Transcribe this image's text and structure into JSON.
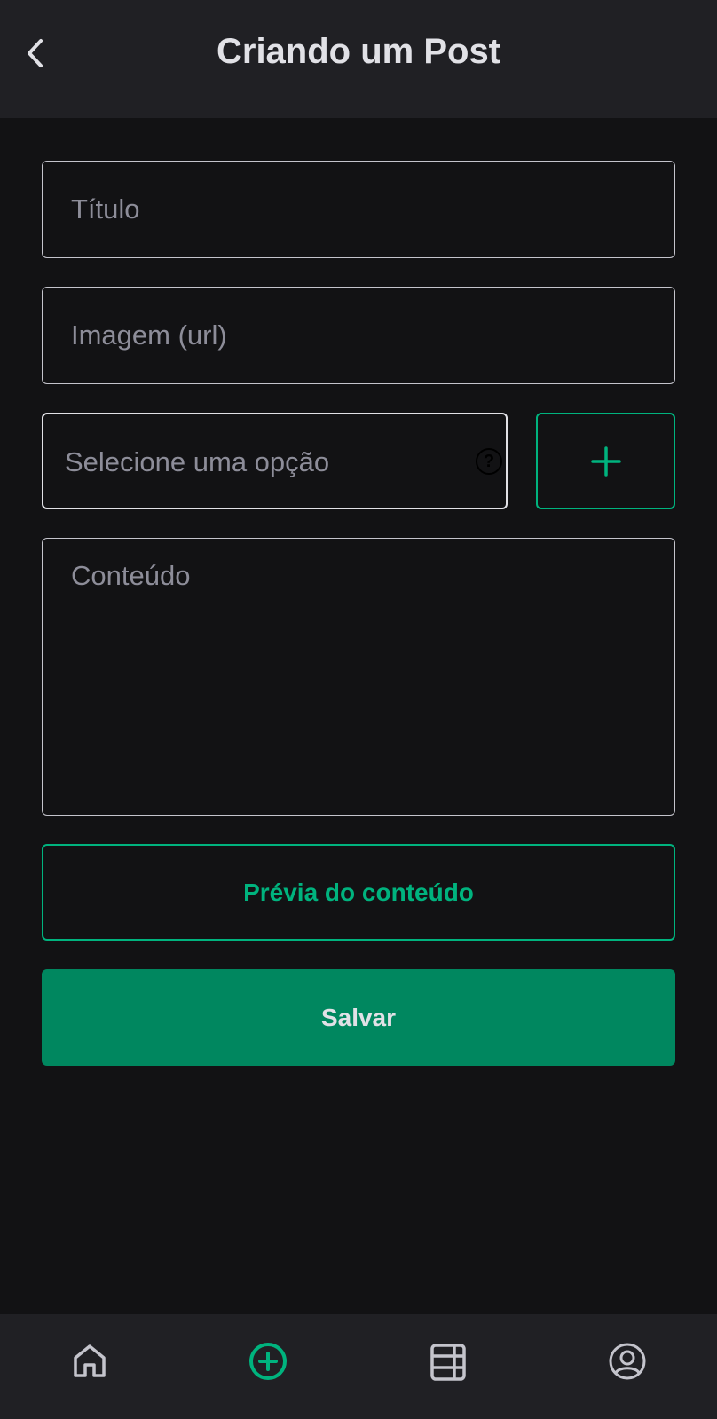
{
  "header": {
    "title": "Criando um Post",
    "back_icon": "chevron-left-icon"
  },
  "form": {
    "title_placeholder": "Título",
    "image_placeholder": "Imagem (url)",
    "select_placeholder": "Selecione uma opção",
    "help_icon": "question-circle-icon",
    "add_icon": "plus-icon",
    "content_placeholder": "Conteúdo",
    "preview_label": "Prévia do conteúdo",
    "save_label": "Salvar"
  },
  "nav": {
    "items": [
      {
        "icon": "home-icon",
        "active": false
      },
      {
        "icon": "plus-circle-icon",
        "active": true
      },
      {
        "icon": "table-icon",
        "active": false
      },
      {
        "icon": "user-circle-icon",
        "active": false
      }
    ]
  },
  "colors": {
    "accent": "#00b37e",
    "primary": "#00875f",
    "background": "#121214",
    "surface": "#202024"
  }
}
